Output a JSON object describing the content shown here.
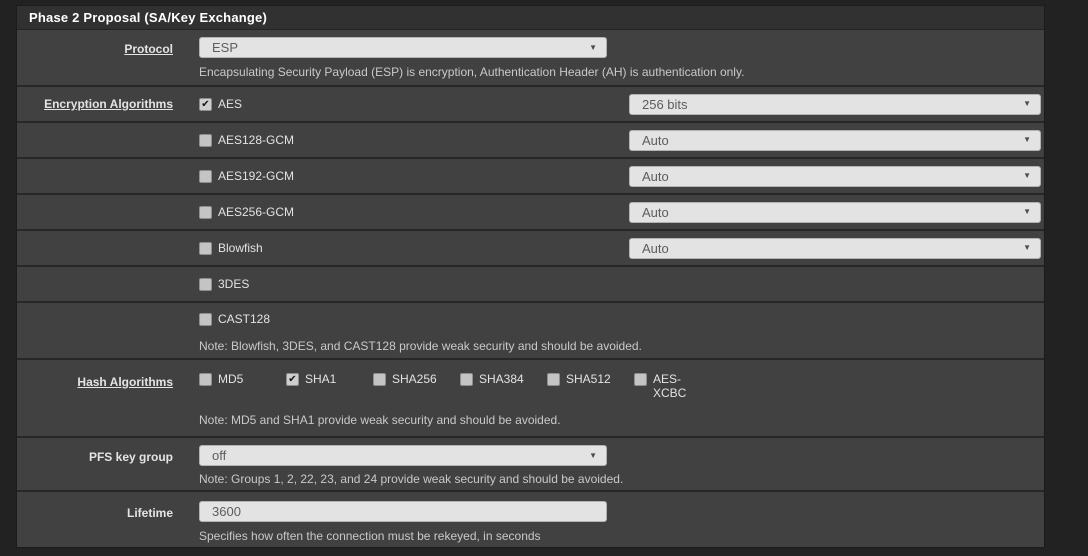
{
  "panel": {
    "title": "Phase 2 Proposal (SA/Key Exchange)"
  },
  "icons": {
    "dropdown_arrow": "▼"
  },
  "protocol": {
    "label": "Protocol",
    "value": "ESP",
    "description": "Encapsulating Security Payload (ESP) is encryption, Authentication Header (AH) is authentication only."
  },
  "encryption": {
    "label": "Encryption Algorithms",
    "rows": [
      {
        "name": "AES",
        "checked": true,
        "select": "256 bits"
      },
      {
        "name": "AES128-GCM",
        "checked": false,
        "select": "Auto"
      },
      {
        "name": "AES192-GCM",
        "checked": false,
        "select": "Auto"
      },
      {
        "name": "AES256-GCM",
        "checked": false,
        "select": "Auto"
      },
      {
        "name": "Blowfish",
        "checked": false,
        "select": "Auto"
      },
      {
        "name": "3DES",
        "checked": false
      },
      {
        "name": "CAST128",
        "checked": false
      }
    ],
    "note": "Note: Blowfish, 3DES, and CAST128 provide weak security and should be avoided."
  },
  "hash": {
    "label": "Hash Algorithms",
    "options": [
      {
        "name": "MD5",
        "checked": false
      },
      {
        "name": "SHA1",
        "checked": true
      },
      {
        "name": "SHA256",
        "checked": false
      },
      {
        "name": "SHA384",
        "checked": false
      },
      {
        "name": "SHA512",
        "checked": false
      },
      {
        "name": "AES-XCBC",
        "checked": false
      }
    ],
    "note": "Note: MD5 and SHA1 provide weak security and should be avoided."
  },
  "pfs": {
    "label": "PFS key group",
    "value": "off",
    "note": "Note: Groups 1, 2, 22, 23, and 24 provide weak security and should be avoided."
  },
  "lifetime": {
    "label": "Lifetime",
    "value": "3600",
    "note": "Specifies how often the connection must be rekeyed, in seconds"
  },
  "colors": {
    "page_bg": "#222222",
    "panel_header_bg": "#313131",
    "row_bg": "#414141",
    "row_border": "#272727",
    "control_bg": "#e3e3e3",
    "control_text": "#5d5d5d",
    "label_text": "#e4e4e4",
    "note_text": "#c9c9c9"
  }
}
